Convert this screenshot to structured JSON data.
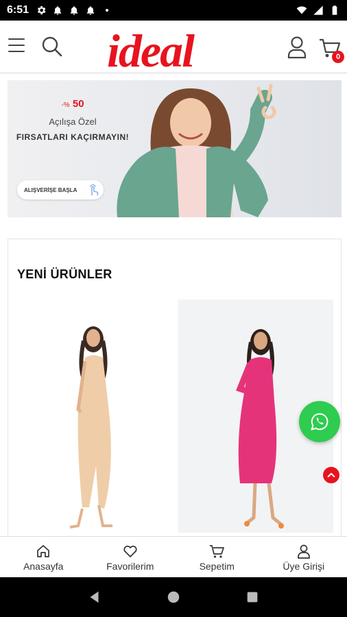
{
  "status_bar": {
    "time": "6:51",
    "left_icons": [
      "gear-icon",
      "notification-bell-icon",
      "notification-bell-icon",
      "notification-bell-icon",
      "dot-icon"
    ],
    "right_icons": [
      "wifi-icon",
      "signal-icon",
      "battery-icon"
    ]
  },
  "header": {
    "logo_text": "ideal",
    "cart_count": "0",
    "brand_color": "#e8131f"
  },
  "banner": {
    "discount": "50",
    "discount_prefix": "-%",
    "subtitle": "Açılışa Özel",
    "headline": "FIRSATLARI KAÇIRMAYIN!",
    "button_label": "ALIŞVERİŞE BAŞLA"
  },
  "products_section": {
    "title": "YENİ ÜRÜNLER",
    "items": [
      {
        "color_name": "beige",
        "dress_color": "#edcfae"
      },
      {
        "color_name": "fuchsia",
        "dress_color": "#e8337a"
      }
    ]
  },
  "floating": {
    "whatsapp_color": "#2ecc4f"
  },
  "bottom_nav": {
    "items": [
      {
        "label": "Anasayfa",
        "icon": "home-icon"
      },
      {
        "label": "Favorilerim",
        "icon": "heart-icon"
      },
      {
        "label": "Sepetim",
        "icon": "cart-icon"
      },
      {
        "label": "Üye Girişi",
        "icon": "user-icon"
      }
    ]
  }
}
